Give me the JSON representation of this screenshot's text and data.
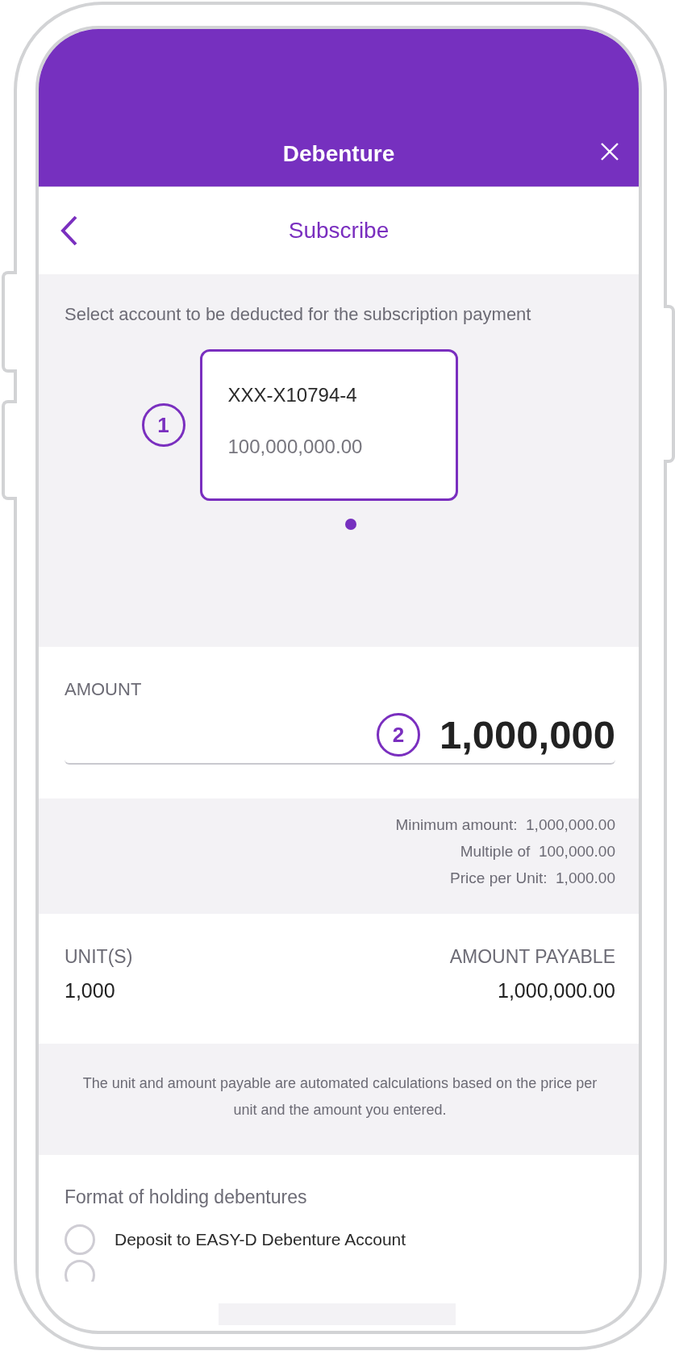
{
  "header": {
    "title": "Debenture"
  },
  "nav": {
    "title": "Subscribe"
  },
  "account_section": {
    "instruction": "Select account to be deducted for the subscription payment",
    "step": "1",
    "accounts": [
      {
        "number": "XXX-X10794-4",
        "balance": "100,000,000.00",
        "selected": true
      }
    ]
  },
  "amount": {
    "label": "AMOUNT",
    "step": "2",
    "value": "1,000,000"
  },
  "limits": [
    {
      "label": "Minimum amount:",
      "value": "1,000,000.00"
    },
    {
      "label": "Multiple of",
      "value": "100,000.00"
    },
    {
      "label": "Price per Unit:",
      "value": "1,000.00"
    }
  ],
  "result": {
    "units_label": "UNIT(S)",
    "units": "1,000",
    "payable_label": "AMOUNT PAYABLE",
    "payable": "1,000,000.00"
  },
  "note": "The unit and amount payable are automated calculations based on the price per unit and the amount you entered.",
  "holding": {
    "label": "Format of holding debentures",
    "options": [
      {
        "label": "Deposit to EASY-D Debenture Account",
        "selected": false
      },
      {
        "selected": false
      }
    ]
  }
}
